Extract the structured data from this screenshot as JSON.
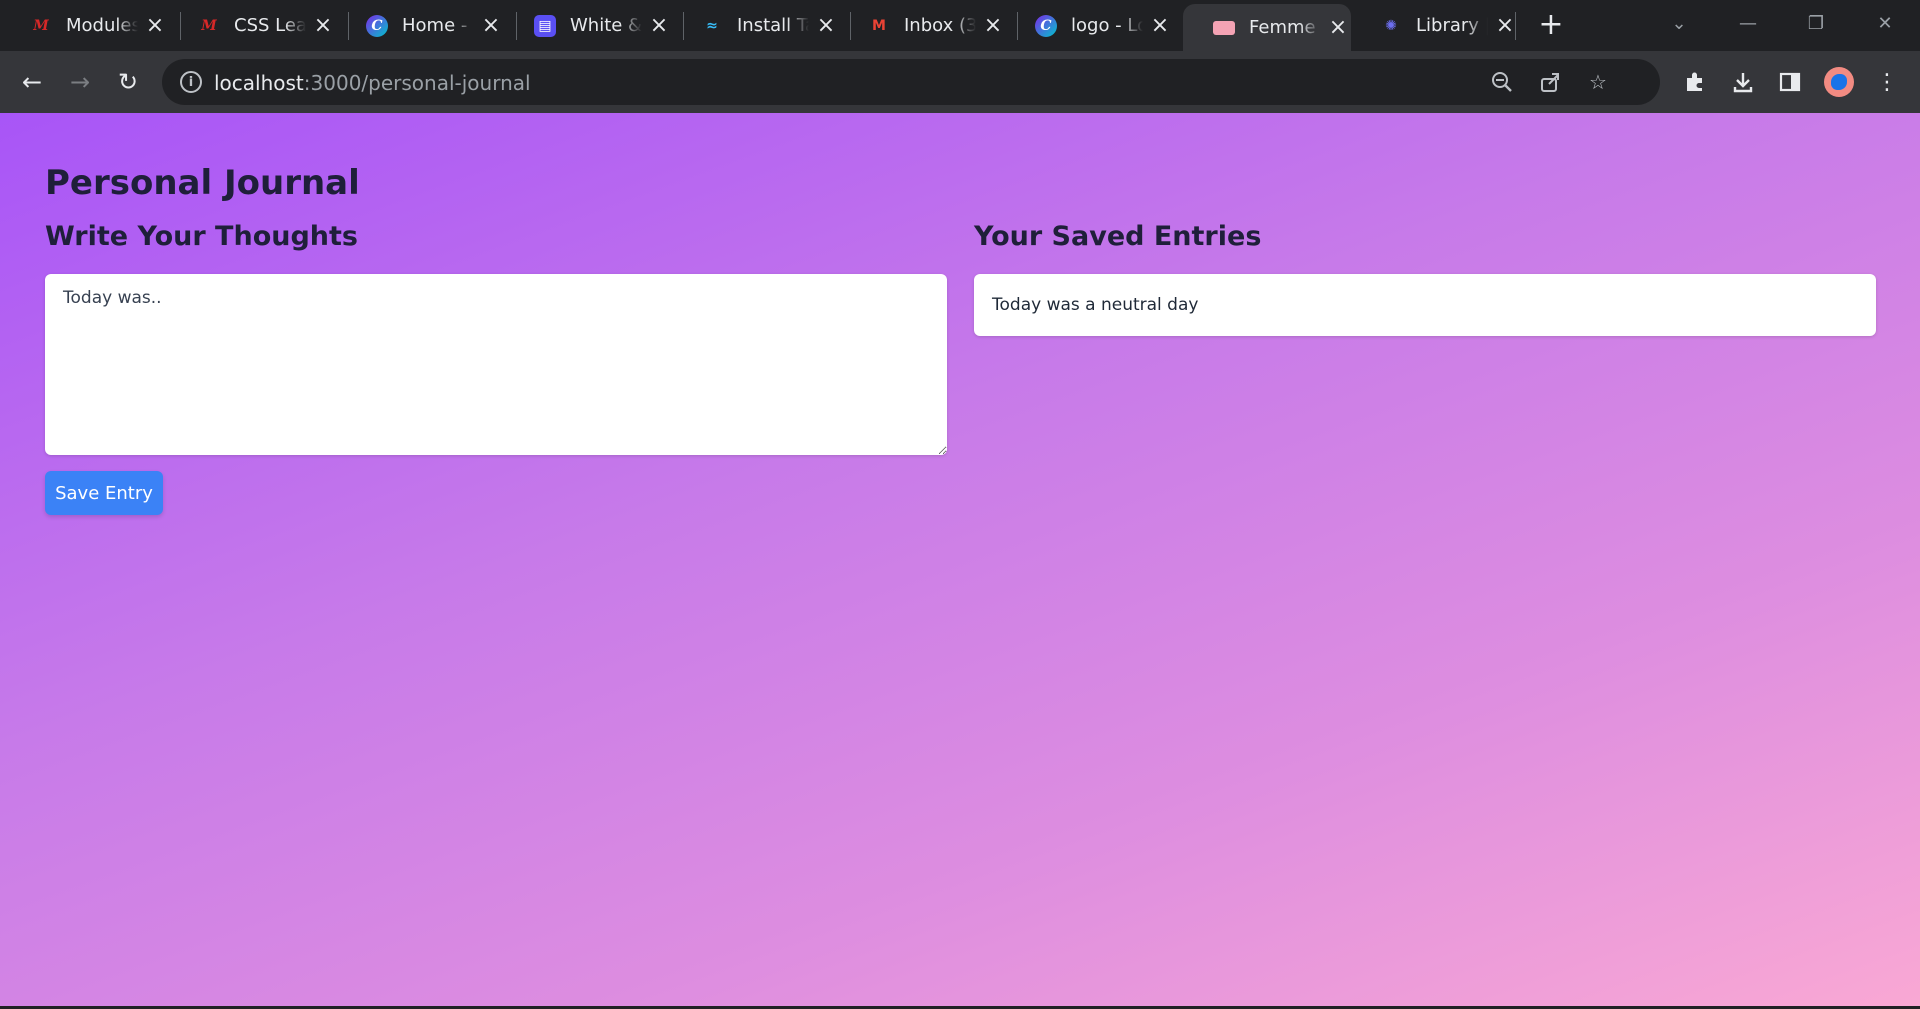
{
  "browser": {
    "tabs": [
      {
        "title": "Modules",
        "favicon": "m-logo-icon",
        "active": false
      },
      {
        "title": "CSS Learn",
        "favicon": "m-logo-icon",
        "active": false
      },
      {
        "title": "Home - C",
        "favicon": "canva-icon",
        "active": false
      },
      {
        "title": "White &",
        "favicon": "printer-icon",
        "active": false
      },
      {
        "title": "Install Ta",
        "favicon": "tailwind-icon",
        "active": false
      },
      {
        "title": "Inbox (3",
        "favicon": "gmail-icon",
        "active": false
      },
      {
        "title": "logo - Lo",
        "favicon": "canva-icon",
        "active": false
      },
      {
        "title": "Femme F",
        "favicon": "femme-icon",
        "active": true
      },
      {
        "title": "Library |",
        "favicon": "library-icon",
        "active": false
      }
    ],
    "url_host": "localhost",
    "url_rest": ":3000/personal-journal"
  },
  "page": {
    "title": "Personal Journal",
    "write_heading": "Write Your Thoughts",
    "entries_heading": "Your Saved Entries",
    "input_placeholder": "Today was..",
    "save_label": "Save Entry",
    "entries": [
      {
        "text": "Today was a neutral day"
      }
    ]
  },
  "colors": {
    "gradient_start": "#a855f7",
    "gradient_end": "#f9a8d4",
    "button": "#3b82f6"
  }
}
